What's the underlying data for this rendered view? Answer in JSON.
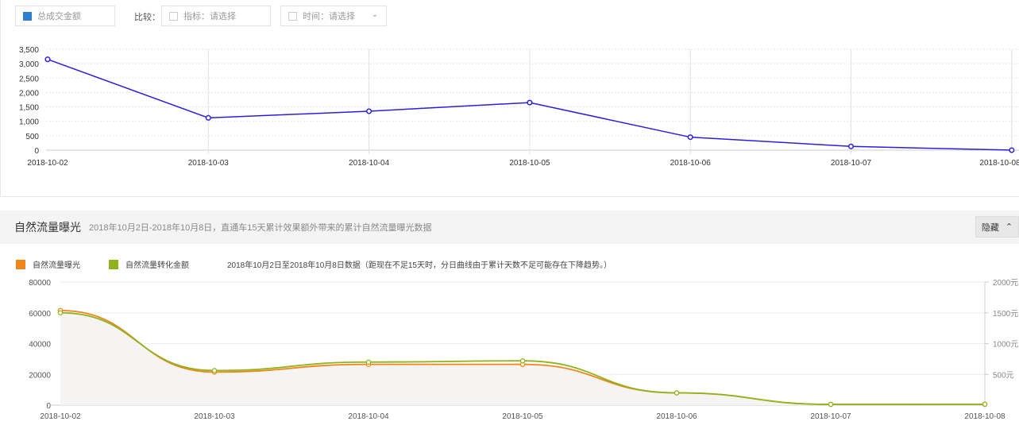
{
  "filters": {
    "metric": "总成交金额",
    "metric_color": "#2f7fd1",
    "compare_label": "比较：",
    "indicator": "指标：请选择",
    "time": "时间：请选择"
  },
  "top_chart": {
    "type": "line",
    "categories": [
      "2018-10-02",
      "2018-10-03",
      "2018-10-04",
      "2018-10-05",
      "2018-10-06",
      "2018-10-07",
      "2018-10-08"
    ],
    "values": [
      3150,
      1120,
      1350,
      1650,
      450,
      130,
      0
    ],
    "yticks": [
      "3,500",
      "3,000",
      "2,500",
      "2,000",
      "1,500",
      "1,000",
      "500",
      "0"
    ],
    "ylim": [
      0,
      3500
    ],
    "color": "#2a1ee0"
  },
  "section": {
    "title": "自然流量曝光",
    "subtitle": "2018年10月2日-2018年10月8日，直通车15天累计效果额外带来的累计自然流量曝光数据",
    "hide_label": "隐藏"
  },
  "legend": [
    {
      "label": "自然流量曝光",
      "color": "#f08519"
    },
    {
      "label": "自然流量转化金额",
      "color": "#8fb31c"
    }
  ],
  "note": "2018年10月2日至2018年10月8日数据（距现在不足15天时，分日曲线由于累计天数不足可能存在下降趋势。）",
  "chart_data": {
    "type": "line",
    "categories": [
      "2018-10-02",
      "2018-10-03",
      "2018-10-04",
      "2018-10-05",
      "2018-10-06",
      "2018-10-07",
      "2018-10-08"
    ],
    "series": [
      {
        "name": "自然流量曝光",
        "values": [
          61500,
          21500,
          26500,
          26500,
          8000,
          500,
          500
        ]
      },
      {
        "name": "自然流量转化金额",
        "values": [
          60000,
          22500,
          28000,
          28800,
          8000,
          500,
          600
        ]
      }
    ],
    "yticks_left": [
      "80000",
      "60000",
      "40000",
      "20000",
      "0"
    ],
    "ylim": [
      0,
      80000
    ],
    "yticks_right": [
      "2000元",
      "1500元",
      "1000元",
      "500元"
    ]
  }
}
